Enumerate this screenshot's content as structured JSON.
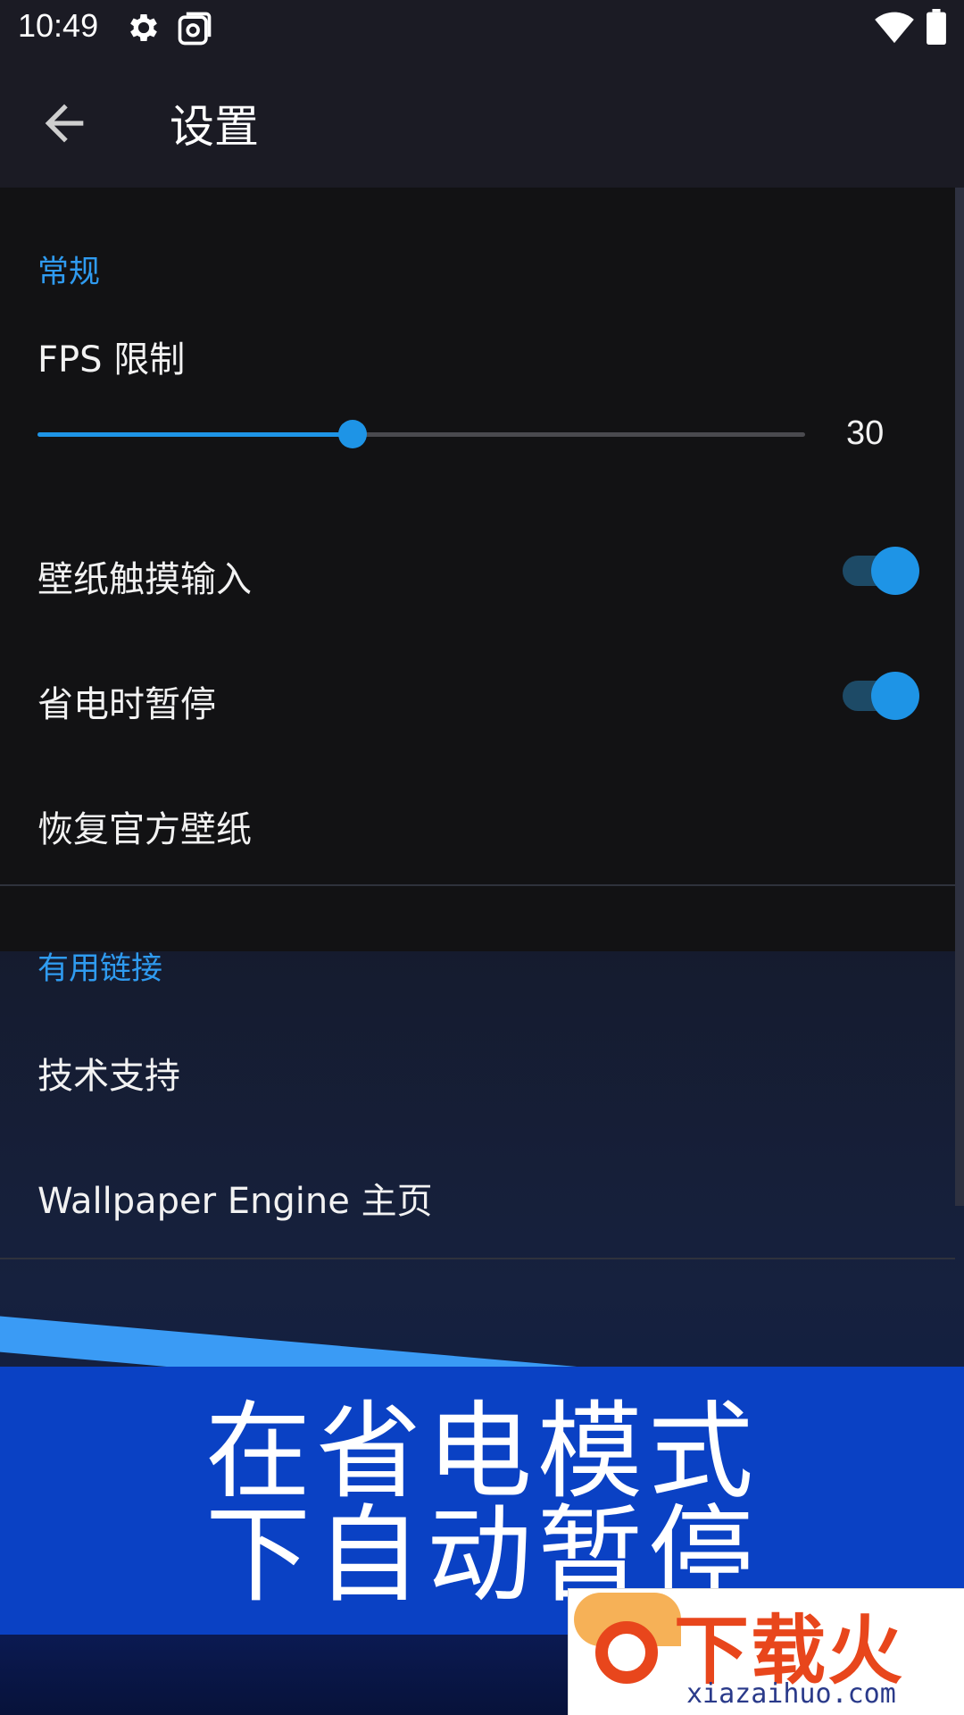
{
  "status_bar": {
    "time": "10:49",
    "icons": [
      "gear-icon",
      "screenshot-icon",
      "wifi-icon",
      "battery-icon"
    ]
  },
  "app_bar": {
    "back_icon": "arrow-left-icon",
    "title": "设置"
  },
  "sections": {
    "general": {
      "label": "常规",
      "fps": {
        "label": "FPS 限制",
        "value": "30",
        "fill_fraction": 0.41
      },
      "touch_input": {
        "label": "壁纸触摸输入",
        "enabled": true
      },
      "pause_power_saving": {
        "label": "省电时暂停",
        "enabled": true
      },
      "restore": {
        "label": "恢复官方壁纸"
      }
    },
    "links": {
      "label": "有用链接",
      "support": {
        "label": "技术支持"
      },
      "homepage": {
        "label": "Wallpaper Engine 主页"
      }
    }
  },
  "banner": {
    "line1": "在省电模式",
    "line2": "下自动暂停"
  },
  "watermark": {
    "title": "下载火",
    "url": "xiazaihuo.com"
  },
  "colors": {
    "accent": "#1e94e6",
    "section_label": "#2f9bf0",
    "banner": "#0a41c4",
    "panel": "#121214",
    "watermark_red": "#e8461c"
  }
}
